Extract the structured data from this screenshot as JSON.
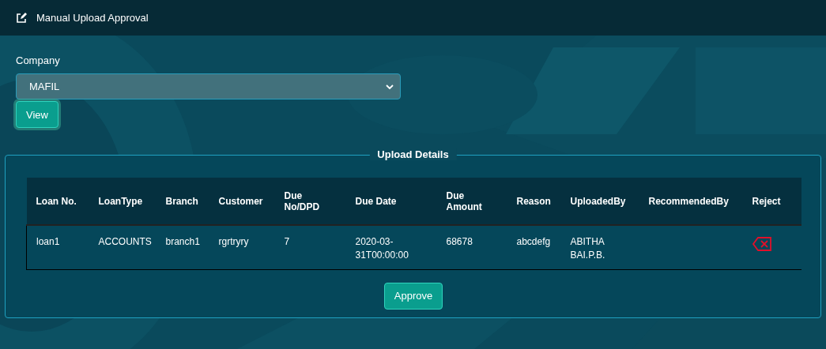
{
  "header": {
    "title": "Manual Upload Approval"
  },
  "company": {
    "label": "Company",
    "value": "MAFIL"
  },
  "view_button": "View",
  "section": {
    "title": "Upload Details"
  },
  "table": {
    "columns": [
      "Loan No.",
      "LoanType",
      "Branch",
      "Customer",
      "Due No/DPD",
      "Due Date",
      "Due Amount",
      "Reason",
      "UploadedBy",
      "RecommendedBy",
      "Reject"
    ],
    "rows": [
      {
        "cells": [
          "loan1",
          "ACCOUNTS",
          "branch1",
          "rgrtryry",
          "7",
          "2020-03-31T00:00:00",
          "68678",
          "abcdefg",
          "ABITHA BAI.P.B."
        ]
      }
    ]
  },
  "approve_button": "Approve"
}
